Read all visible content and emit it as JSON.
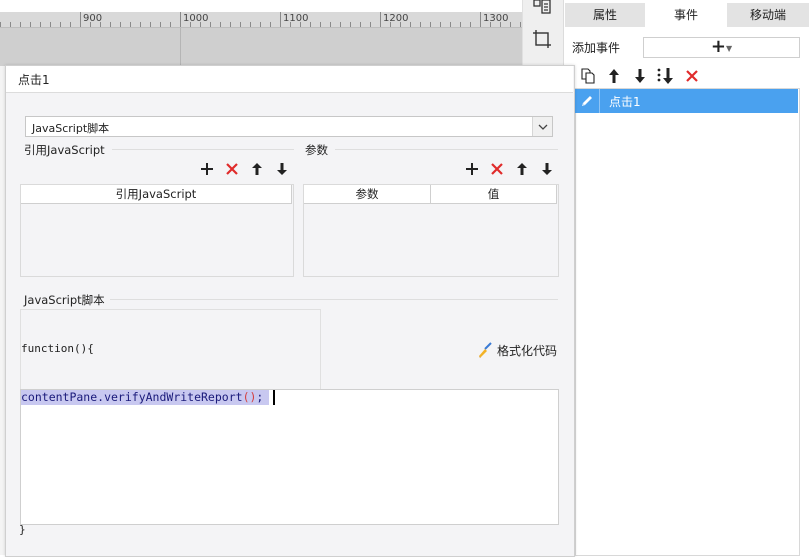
{
  "ruler": {
    "labels": [
      "900",
      "1000",
      "1100",
      "1200",
      "1300"
    ]
  },
  "right_panel": {
    "tabs": [
      {
        "label": "属性"
      },
      {
        "label": "事件"
      },
      {
        "label": "移动端"
      }
    ],
    "add_event": {
      "label": "添加事件",
      "button_glyph": "+"
    },
    "toolbar_icons": [
      "copy-icon",
      "arrow-up-icon",
      "arrow-down-icon",
      "move-bottom-icon",
      "delete-icon"
    ],
    "events": [
      {
        "label": "点击1",
        "icon": "pencil-icon"
      }
    ]
  },
  "dialog": {
    "title": "点击1",
    "script_type": {
      "value": "JavaScript脚本"
    },
    "ref_js": {
      "label": "引用JavaScript",
      "columns": [
        "引用JavaScript"
      ]
    },
    "params": {
      "label": "参数",
      "columns": [
        "参数",
        "值"
      ]
    },
    "script": {
      "label": "JavaScript脚本",
      "fn_open": "function(){",
      "code_plain": "contentPane.verifyAndWriteReport",
      "code_parens": "()",
      "code_end": ";",
      "fn_close": "}",
      "format_label": "格式化代码"
    }
  },
  "colors": {
    "accent": "#4aa1ef",
    "delete_red": "#e02b2b",
    "code_highlight": "#c8c8f0"
  }
}
